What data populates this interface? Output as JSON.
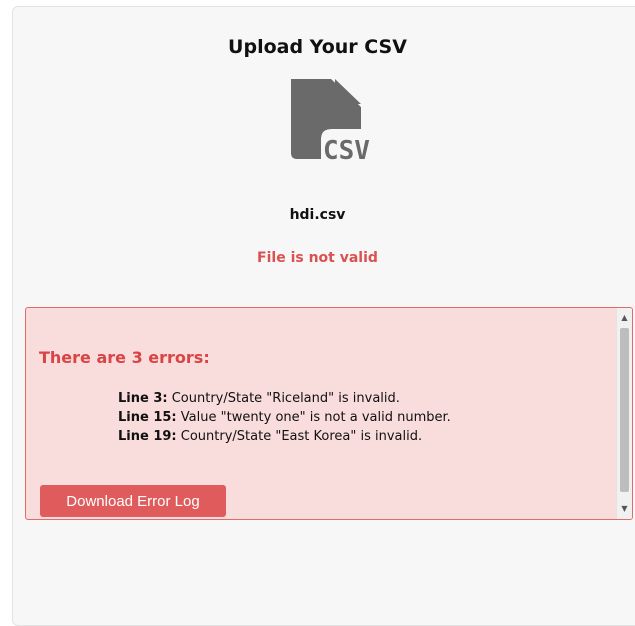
{
  "upload": {
    "title": "Upload Your CSV",
    "file_icon": "csv-file-icon",
    "file_icon_text": "CSV",
    "filename": "hdi.csv",
    "status": "File is not valid"
  },
  "errors": {
    "heading": "There are 3 errors:",
    "items": [
      {
        "line": "Line 3:",
        "message": "Country/State \"Riceland\" is invalid."
      },
      {
        "line": "Line 15:",
        "message": "Value \"twenty one\" is not a valid number."
      },
      {
        "line": "Line 19:",
        "message": "Country/State \"East Korea\" is invalid."
      }
    ],
    "download_label": "Download Error Log"
  },
  "colors": {
    "error_text": "#dc5050",
    "error_bg": "#f9dcdc",
    "error_border": "#df6b6b",
    "button_bg": "#e05c5c",
    "icon": "#6a6a6a"
  }
}
